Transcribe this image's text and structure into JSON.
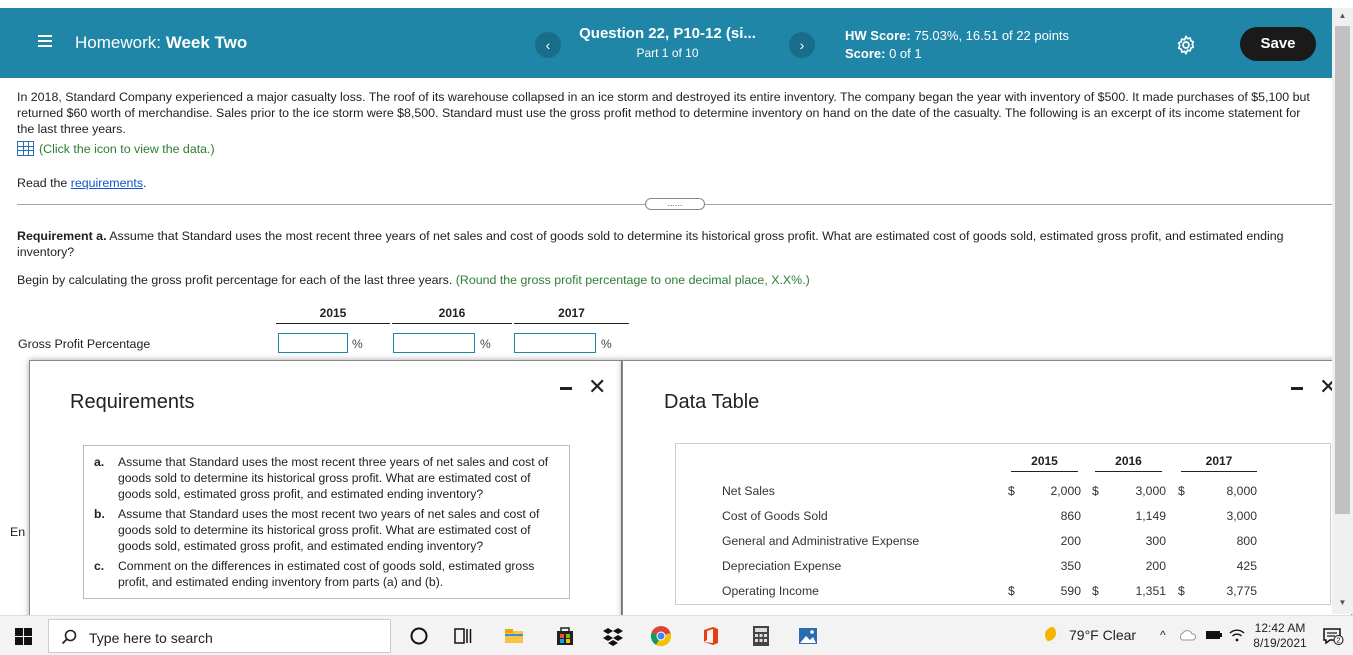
{
  "header": {
    "menu_label": "Homework:",
    "assignment": "Week Two",
    "question_title": "Question 22, P10-12 (si...",
    "question_part": "Part 1 of 10",
    "hw_score_label": "HW Score:",
    "hw_score_value": "75.03%, 16.51 of 22 points",
    "score_label": "Score:",
    "score_value": "0 of 1",
    "prev": "‹",
    "next": "›",
    "save": "Save"
  },
  "question": {
    "text": "In 2018, Standard Company experienced a major casualty loss. The roof of its warehouse collapsed in an ice storm and destroyed its entire inventory. The company began the year with inventory of $500. It made purchases of $5,100 but returned $60 worth of merchandise. Sales prior to the ice storm were $8,500. Standard must use the gross profit method to determine inventory on hand on the date of the casualty. The following is an excerpt of its income statement for the last three years.",
    "click_icon": "(Click the icon to view the data.)",
    "read_prefix": "Read the ",
    "read_link": "requirements",
    "read_suffix": ".",
    "divider_dots": "......",
    "req_a_bold": "Requirement a.",
    "req_a_text": " Assume that Standard uses the most recent three years of net sales and cost of goods sold to determine its historical gross profit. What are estimated cost of goods sold, estimated gross profit, and estimated ending inventory?",
    "begin_text": "Begin by calculating the gross profit percentage for each of the last three years. ",
    "begin_hint": "(Round the gross profit percentage to one decimal place, X.X%.)",
    "years": [
      "2015",
      "2016",
      "2017"
    ],
    "row_label": "Gross Profit Percentage",
    "pct": "%",
    "cut_text": "En"
  },
  "requirements_popup": {
    "title": "Requirements",
    "items": [
      {
        "letter": "a.",
        "text": "Assume that Standard uses the most recent three years of net sales and cost of goods sold to determine its historical gross profit. What are estimated cost of goods sold, estimated gross profit, and estimated ending inventory?"
      },
      {
        "letter": "b.",
        "text": "Assume that Standard uses the most recent two years of net sales and cost of goods sold to determine its historical gross profit. What are estimated cost of goods sold, estimated gross profit, and estimated ending inventory?"
      },
      {
        "letter": "c.",
        "text": "Comment on the differences in estimated cost of goods sold, estimated gross profit, and estimated ending inventory from parts (a) and (b)."
      }
    ],
    "close": "✕"
  },
  "data_popup": {
    "title": "Data Table",
    "years": [
      "2015",
      "2016",
      "2017"
    ],
    "rows": [
      {
        "label": "Net Sales",
        "cur1": "$",
        "v1": "2,000",
        "cur2": "$",
        "v2": "3,000",
        "cur3": "$",
        "v3": "8,000"
      },
      {
        "label": "Cost of Goods Sold",
        "cur1": "",
        "v1": "860",
        "cur2": "",
        "v2": "1,149",
        "cur3": "",
        "v3": "3,000"
      },
      {
        "label": "General and Administrative Expense",
        "cur1": "",
        "v1": "200",
        "cur2": "",
        "v2": "300",
        "cur3": "",
        "v3": "800"
      },
      {
        "label": "Depreciation Expense",
        "cur1": "",
        "v1": "350",
        "cur2": "",
        "v2": "200",
        "cur3": "",
        "v3": "425"
      },
      {
        "label": "Operating Income",
        "cur1": "$",
        "v1": "590",
        "cur2": "$",
        "v2": "1,351",
        "cur3": "$",
        "v3": "3,775"
      }
    ],
    "close": "✕"
  },
  "taskbar": {
    "search_placeholder": "Type here to search",
    "weather": "79°F  Clear",
    "time": "12:42 AM",
    "date": "8/19/2021",
    "notification_count": "2"
  }
}
